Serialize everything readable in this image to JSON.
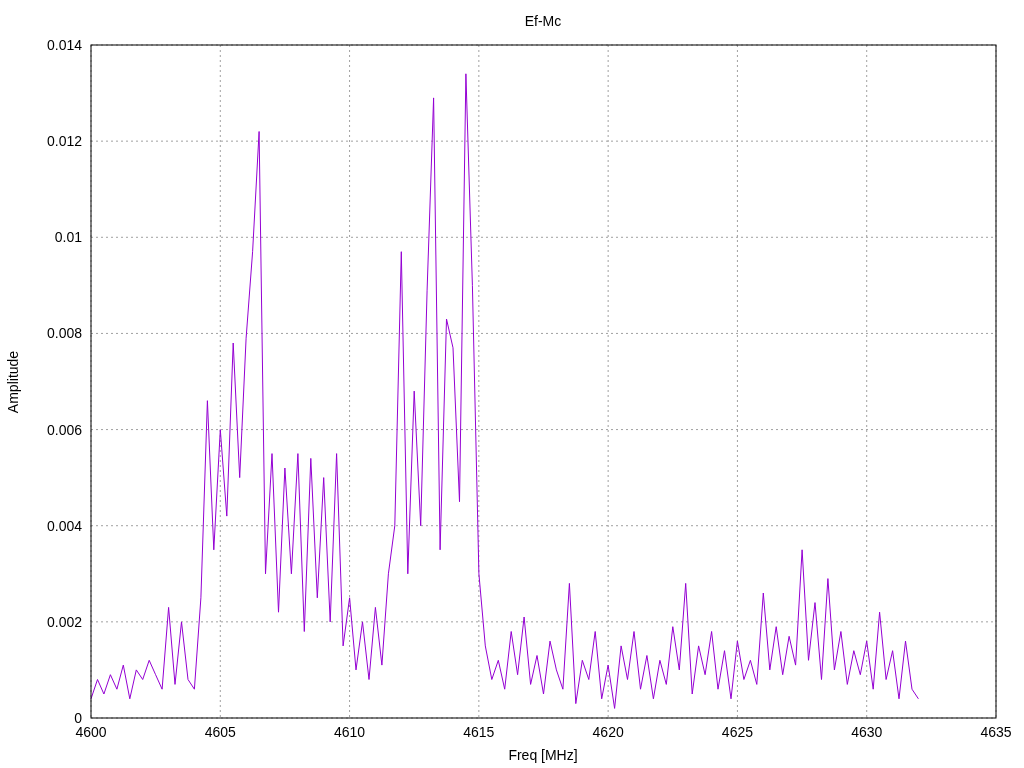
{
  "chart_data": {
    "type": "line",
    "grid": true,
    "title": "Ef-Mc",
    "xlabel": "Freq [MHz]",
    "ylabel": "Amplitude",
    "xlim": [
      4600,
      4635
    ],
    "ylim": [
      0,
      0.014
    ],
    "xticks": [
      4600,
      4605,
      4610,
      4615,
      4620,
      4625,
      4630,
      4635
    ],
    "yticks": [
      0,
      0.002,
      0.004,
      0.006,
      0.008,
      0.01,
      0.012,
      0.014
    ],
    "x": [
      4600,
      4600.25,
      4600.5,
      4600.75,
      4601,
      4601.25,
      4601.5,
      4601.75,
      4602,
      4602.25,
      4602.5,
      4602.75,
      4603,
      4603.25,
      4603.5,
      4603.75,
      4604,
      4604.25,
      4604.5,
      4604.75,
      4605,
      4605.25,
      4605.5,
      4605.75,
      4606,
      4606.25,
      4606.5,
      4606.75,
      4607,
      4607.25,
      4607.5,
      4607.75,
      4608,
      4608.25,
      4608.5,
      4608.75,
      4609,
      4609.25,
      4609.5,
      4609.75,
      4610,
      4610.25,
      4610.5,
      4610.75,
      4611,
      4611.25,
      4611.5,
      4611.75,
      4612,
      4612.25,
      4612.5,
      4612.75,
      4613,
      4613.25,
      4613.5,
      4613.75,
      4614,
      4614.25,
      4614.5,
      4614.75,
      4615,
      4615.25,
      4615.5,
      4615.75,
      4616,
      4616.25,
      4616.5,
      4616.75,
      4617,
      4617.25,
      4617.5,
      4617.75,
      4618,
      4618.25,
      4618.5,
      4618.75,
      4619,
      4619.25,
      4619.5,
      4619.75,
      4620,
      4620.25,
      4620.5,
      4620.75,
      4621,
      4621.25,
      4621.5,
      4621.75,
      4622,
      4622.25,
      4622.5,
      4622.75,
      4623,
      4623.25,
      4623.5,
      4623.75,
      4624,
      4624.25,
      4624.5,
      4624.75,
      4625,
      4625.25,
      4625.5,
      4625.75,
      4626,
      4626.25,
      4626.5,
      4626.75,
      4627,
      4627.25,
      4627.5,
      4627.75,
      4628,
      4628.25,
      4628.5,
      4628.75,
      4629,
      4629.25,
      4629.5,
      4629.75,
      4630,
      4630.25,
      4630.5,
      4630.75,
      4631,
      4631.25,
      4631.5,
      4631.75,
      4632
    ],
    "series": [
      {
        "color": "#9400d3",
        "values": [
          0.0004,
          0.0008,
          0.0005,
          0.0009,
          0.0006,
          0.0011,
          0.0004,
          0.001,
          0.0008,
          0.0012,
          0.0009,
          0.0006,
          0.0023,
          0.0007,
          0.002,
          0.0008,
          0.0006,
          0.0025,
          0.0066,
          0.0035,
          0.006,
          0.0042,
          0.0078,
          0.005,
          0.0079,
          0.0097,
          0.0122,
          0.003,
          0.0055,
          0.0022,
          0.0052,
          0.003,
          0.0055,
          0.0018,
          0.0054,
          0.0025,
          0.005,
          0.002,
          0.0055,
          0.0015,
          0.0025,
          0.001,
          0.002,
          0.0008,
          0.0023,
          0.0011,
          0.003,
          0.004,
          0.0097,
          0.003,
          0.0068,
          0.004,
          0.0089,
          0.0129,
          0.0035,
          0.0083,
          0.0077,
          0.0045,
          0.0134,
          0.009,
          0.003,
          0.0015,
          0.0008,
          0.0012,
          0.0006,
          0.0018,
          0.0009,
          0.0021,
          0.0007,
          0.0013,
          0.0005,
          0.0016,
          0.001,
          0.0006,
          0.0028,
          0.0003,
          0.0012,
          0.0008,
          0.0018,
          0.0004,
          0.0011,
          0.0002,
          0.0015,
          0.0008,
          0.0018,
          0.0006,
          0.0013,
          0.0004,
          0.0012,
          0.0007,
          0.0019,
          0.001,
          0.0028,
          0.0005,
          0.0015,
          0.0009,
          0.0018,
          0.0006,
          0.0014,
          0.0004,
          0.0016,
          0.0008,
          0.0012,
          0.0007,
          0.0026,
          0.001,
          0.0019,
          0.0009,
          0.0017,
          0.0011,
          0.0035,
          0.0012,
          0.0024,
          0.0008,
          0.0029,
          0.001,
          0.0018,
          0.0007,
          0.0014,
          0.0009,
          0.0016,
          0.0006,
          0.0022,
          0.0008,
          0.0014,
          0.0004,
          0.0016,
          0.0006,
          0.0004
        ]
      }
    ]
  }
}
